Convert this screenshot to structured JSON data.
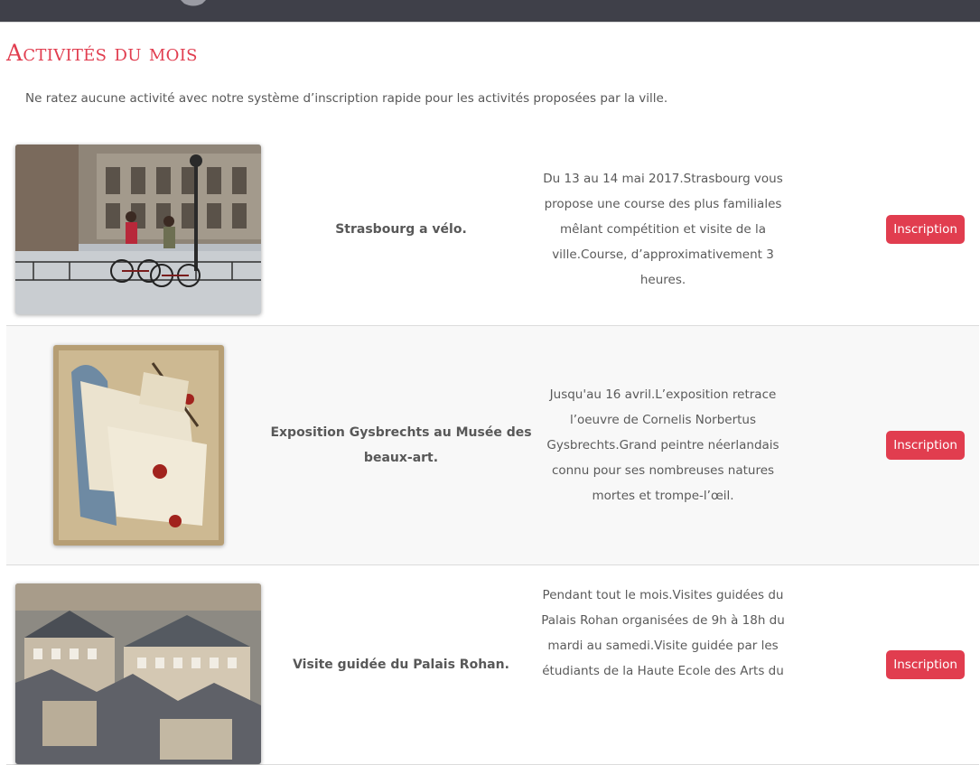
{
  "page": {
    "title": "Activités du mois",
    "intro": "Ne ratez aucune activité avec notre système d’inscription rapide pour les activités proposées par la ville."
  },
  "activities": [
    {
      "name": "Strasbourg a vélo.",
      "description": "Du 13 au 14 mai 2017.Strasbourg vous propose une course des plus familiales mêlant compétition et visite de la ville.Course, d’approximativement 3 heures.",
      "button": "Inscription",
      "image": "cyclists-photo"
    },
    {
      "name": "Exposition Gysbrechts au Musée des beaux-art.",
      "description": "Jusqu'au 16 avril.L’exposition retrace l’oeuvre de Cornelis Norbertus Gysbrechts.Grand peintre néerlandais connu pour ses nombreuses natures mortes et trompe-l’œil.",
      "button": "Inscription",
      "image": "still-life-painting"
    },
    {
      "name": "Visite guidée du Palais Rohan.",
      "description": "Pendant tout le mois.Visites guidées du Palais Rohan organisées de 9h à 18h du mardi au samedi.Visite guidée par les étudiants de la Haute Ecole des Arts du",
      "button": "Inscription",
      "image": "palace-rooftops-photo"
    }
  ],
  "colors": {
    "accent": "#e13d4f",
    "topbar": "#3f4049"
  }
}
